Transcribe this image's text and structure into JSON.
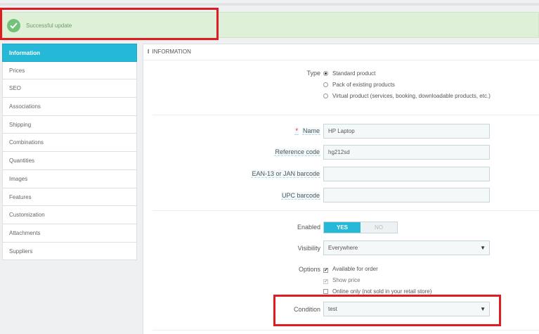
{
  "alert": {
    "message": "Successful update",
    "icon": "check-circle-icon"
  },
  "tabs": [
    {
      "label": "Information",
      "active": true
    },
    {
      "label": "Prices"
    },
    {
      "label": "SEO"
    },
    {
      "label": "Associations"
    },
    {
      "label": "Shipping"
    },
    {
      "label": "Combinations"
    },
    {
      "label": "Quantities"
    },
    {
      "label": "Images"
    },
    {
      "label": "Features"
    },
    {
      "label": "Customization"
    },
    {
      "label": "Attachments"
    },
    {
      "label": "Suppliers"
    }
  ],
  "panel": {
    "heading_icon": "i",
    "heading": "INFORMATION"
  },
  "form": {
    "type_label": "Type",
    "type_options": [
      {
        "label": "Standard product",
        "selected": true
      },
      {
        "label": "Pack of existing products",
        "selected": false
      },
      {
        "label": "Virtual product (services, booking, downloadable products, etc.)",
        "selected": false
      }
    ],
    "name_required": "*",
    "name_label": "Name",
    "name_value": "HP Laptop",
    "reference_label": "Reference code",
    "reference_value": "hg212sd",
    "ean_label": "EAN-13 or JAN barcode",
    "ean_value": "",
    "upc_label": "UPC barcode",
    "upc_value": "",
    "enabled_label": "Enabled",
    "enabled_yes": "YES",
    "enabled_no": "NO",
    "visibility_label": "Visibility",
    "visibility_value": "Everywhere",
    "options_label": "Options",
    "options": [
      {
        "label": "Available for order",
        "checked": true
      },
      {
        "label": "Show price",
        "checked": true,
        "disabled": true
      },
      {
        "label": "Online only (not sold in your retail store)",
        "checked": false
      }
    ],
    "condition_label": "Condition",
    "condition_value": "test"
  },
  "colors": {
    "accent": "#25b9d7",
    "success_bg": "#dff0d8",
    "highlight_border": "#e11b22"
  }
}
